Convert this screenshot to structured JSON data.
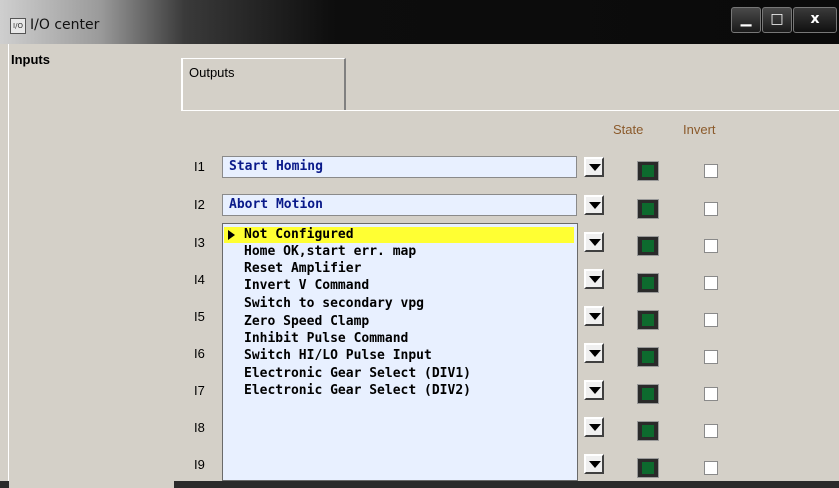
{
  "window": {
    "title": "I/O center",
    "app_icon": "I/O",
    "min_label": "▁",
    "max_label": "□",
    "close_label": "x"
  },
  "tabs": {
    "inputs": "Inputs",
    "outputs": "Outputs"
  },
  "columns": {
    "state": "State",
    "invert": "Invert"
  },
  "rows": [
    {
      "label": "I1",
      "value": "Start Homing"
    },
    {
      "label": "I2",
      "value": "Abort Motion"
    },
    {
      "label": "I3",
      "value": ""
    },
    {
      "label": "I4",
      "value": ""
    },
    {
      "label": "I5",
      "value": ""
    },
    {
      "label": "I6",
      "value": ""
    },
    {
      "label": "I7",
      "value": ""
    },
    {
      "label": "I8",
      "value": ""
    },
    {
      "label": "I9",
      "value": ""
    }
  ],
  "dropdown": {
    "options": [
      "Not Configured",
      "Home OK,start err. map",
      "Reset Amplifier",
      "Invert V Command",
      "Switch to secondary vpg",
      "Zero Speed Clamp",
      "Inhibit Pulse Command",
      "Switch HI/LO Pulse Input",
      "Electronic Gear Select (DIV1)",
      "Electronic Gear Select (DIV2)"
    ],
    "selected_index": 0
  },
  "colors": {
    "accent_highlight": "#ffff33",
    "field_bg": "#e8f0ff",
    "field_text": "#0a1a8a",
    "led_on": "#0d6a2e",
    "header_text": "#8b5a2b"
  }
}
